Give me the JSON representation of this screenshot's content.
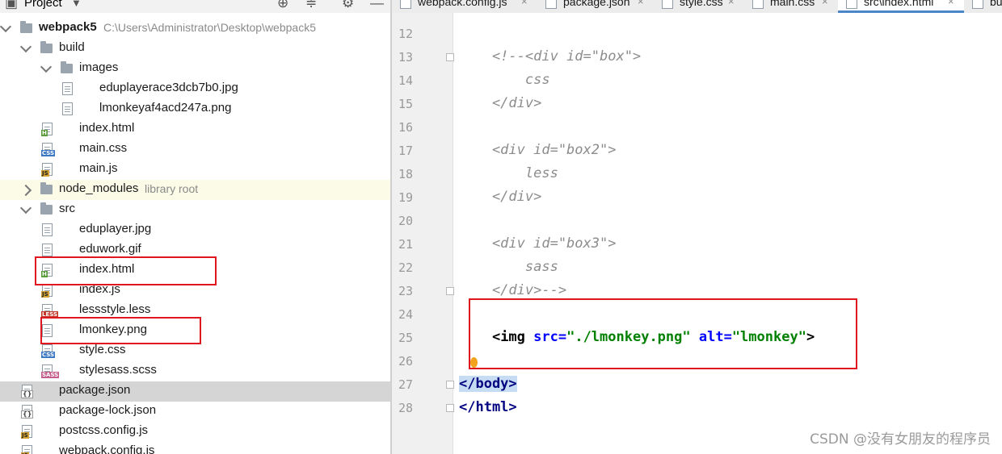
{
  "project_panel": {
    "title": "Project",
    "tree": [
      {
        "label": "webpack5",
        "hint": "C:\\Users\\Administrator\\Desktop\\webpack5",
        "kind": "folder",
        "depth": 0,
        "expanded": true,
        "bold": true
      },
      {
        "label": "build",
        "kind": "folder",
        "depth": 1,
        "expanded": true
      },
      {
        "label": "images",
        "kind": "folder",
        "depth": 2,
        "expanded": true
      },
      {
        "label": "eduplayerace3dcb7b0.jpg",
        "kind": "image",
        "depth": 3
      },
      {
        "label": "lmonkeyaf4acd247a.png",
        "kind": "image",
        "depth": 3
      },
      {
        "label": "index.html",
        "kind": "html",
        "depth": 2
      },
      {
        "label": "main.css",
        "kind": "css",
        "depth": 2
      },
      {
        "label": "main.js",
        "kind": "js",
        "depth": 2
      },
      {
        "label": "node_modules",
        "hint": "library root",
        "kind": "folder",
        "depth": 1,
        "expanded": false
      },
      {
        "label": "src",
        "kind": "folder",
        "depth": 1,
        "expanded": true
      },
      {
        "label": "eduplayer.jpg",
        "kind": "image",
        "depth": 2
      },
      {
        "label": "eduwork.gif",
        "kind": "image",
        "depth": 2
      },
      {
        "label": "index.html",
        "kind": "html",
        "depth": 2,
        "highlighted": true
      },
      {
        "label": "index.js",
        "kind": "js",
        "depth": 2
      },
      {
        "label": "lessstyle.less",
        "kind": "less",
        "depth": 2
      },
      {
        "label": "lmonkey.png",
        "kind": "image",
        "depth": 2,
        "highlighted": true
      },
      {
        "label": "style.css",
        "kind": "css",
        "depth": 2
      },
      {
        "label": "stylesass.scss",
        "kind": "sass",
        "depth": 2
      },
      {
        "label": "package.json",
        "kind": "json",
        "depth": 1,
        "selected": true
      },
      {
        "label": "package-lock.json",
        "kind": "json",
        "depth": 1
      },
      {
        "label": "postcss.config.js",
        "kind": "js",
        "depth": 1
      },
      {
        "label": "webpack.config.js",
        "kind": "js",
        "depth": 1
      }
    ]
  },
  "editor": {
    "tabs": [
      {
        "label": "webpack.config.js",
        "active": false
      },
      {
        "label": "package.json",
        "active": false
      },
      {
        "label": "style.css",
        "active": false
      },
      {
        "label": "main.css",
        "active": false
      },
      {
        "label": "src\\index.html",
        "active": true
      },
      {
        "label": "bu",
        "active": false
      }
    ],
    "lines": [
      {
        "num": "12",
        "text": ""
      },
      {
        "num": "13",
        "text": "    <!--<div id=\"box\">",
        "style": "comment",
        "fold": true
      },
      {
        "num": "14",
        "text": "        css",
        "style": "comment"
      },
      {
        "num": "15",
        "text": "    </div>",
        "style": "comment"
      },
      {
        "num": "16",
        "text": ""
      },
      {
        "num": "17",
        "text": "    <div id=\"box2\">",
        "style": "comment"
      },
      {
        "num": "18",
        "text": "        less",
        "style": "comment"
      },
      {
        "num": "19",
        "text": "    </div>",
        "style": "comment"
      },
      {
        "num": "20",
        "text": ""
      },
      {
        "num": "21",
        "text": "    <div id=\"box3\">",
        "style": "comment"
      },
      {
        "num": "22",
        "text": "        sass",
        "style": "comment"
      },
      {
        "num": "23",
        "text": "    </div>-->",
        "style": "comment",
        "fold": true
      },
      {
        "num": "24",
        "text": ""
      },
      {
        "num": "25",
        "text": "    <img src=\"./lmonkey.png\" alt=\"lmonkey\">",
        "style": "code"
      },
      {
        "num": "26",
        "text": ""
      },
      {
        "num": "27",
        "text": "</body>",
        "style": "tag",
        "fold": true,
        "tag_highlight": true
      },
      {
        "num": "28",
        "text": "</html>",
        "style": "tag",
        "fold": true
      }
    ],
    "img_line": {
      "open": "<img ",
      "src_attr": "src=",
      "src_val": "\"./lmonkey.png\"",
      "alt_attr": " alt=",
      "alt_val": "\"lmonkey\"",
      "close": ">"
    }
  },
  "watermark": "CSDN @没有女朋友的程序员",
  "colors": {
    "highlight_box": "#e0171e",
    "selected_row": "#d5d5d5",
    "comment": "#8c8c8c",
    "tag": "#000080",
    "attr": "#0000ff",
    "string": "#008000"
  }
}
